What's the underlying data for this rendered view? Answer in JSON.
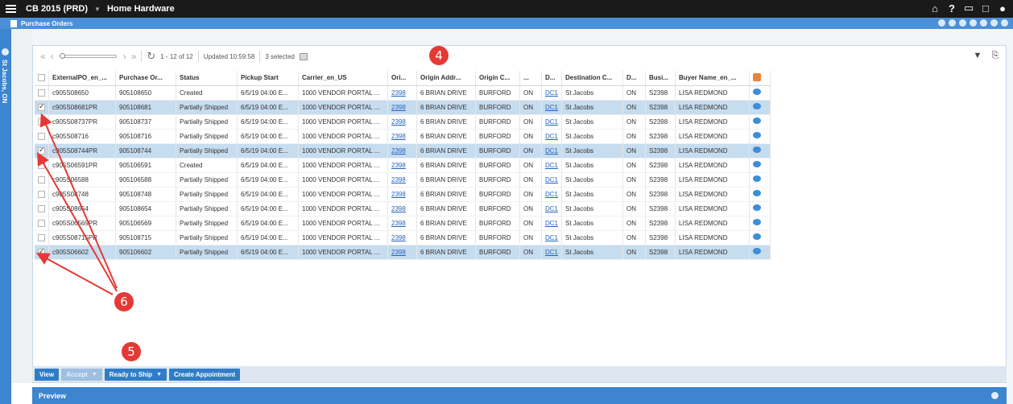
{
  "topbar": {
    "app_title": "CB 2015 (PRD)",
    "company": "Home Hardware",
    "icons": [
      "home-icon",
      "help-icon",
      "window-icon",
      "maximize-icon",
      "user-icon"
    ]
  },
  "module": {
    "title": "Purchase Orders"
  },
  "leftrail": {
    "location": "St Jacobs, ON"
  },
  "toolbar": {
    "range": "1 - 12 of 12",
    "updated": "Updated 10:59:58",
    "selected": "3 selected"
  },
  "table": {
    "columns": [
      "ExternalPO_en_...",
      "Purchase Or...",
      "Status",
      "Pickup Start",
      "Carrier_en_US",
      "Ori...",
      "Origin Addr...",
      "Origin C...",
      "...",
      "D...",
      "Destination C...",
      "D...",
      "Busi...",
      "Buyer Name_en_..."
    ],
    "rows": [
      {
        "checked": false,
        "ext": "c905S08650",
        "po": "905108650",
        "status": "Created",
        "pickup": "6/5/19 04:00 E...",
        "carrier": "1000 VENDOR PORTAL ...",
        "origin": "2398",
        "addr": "6 BRIAN DRIVE",
        "city": "BURFORD",
        "prov": "ON",
        "dest": "DC1",
        "destcity": "St Jacobs",
        "dprov": "ON",
        "bus": "S2398",
        "buyer": "LISA REDMOND"
      },
      {
        "checked": true,
        "ext": "c905S08681PR",
        "po": "905108681",
        "status": "Partially Shipped",
        "pickup": "6/5/19 04:00 E...",
        "carrier": "1000 VENDOR PORTAL ...",
        "origin": "2398",
        "addr": "6 BRIAN DRIVE",
        "city": "BURFORD",
        "prov": "ON",
        "dest": "DC1",
        "destcity": "St Jacobs",
        "dprov": "ON",
        "bus": "S2398",
        "buyer": "LISA REDMOND"
      },
      {
        "checked": false,
        "ext": "c905S08737PR",
        "po": "905108737",
        "status": "Partially Shipped",
        "pickup": "6/5/19 04:00 E...",
        "carrier": "1000 VENDOR PORTAL ...",
        "origin": "2398",
        "addr": "6 BRIAN DRIVE",
        "city": "BURFORD",
        "prov": "ON",
        "dest": "DC1",
        "destcity": "St Jacobs",
        "dprov": "ON",
        "bus": "S2398",
        "buyer": "LISA REDMOND"
      },
      {
        "checked": false,
        "ext": "c905S08716",
        "po": "905108716",
        "status": "Partially Shipped",
        "pickup": "6/5/19 04:00 E...",
        "carrier": "1000 VENDOR PORTAL ...",
        "origin": "2398",
        "addr": "6 BRIAN DRIVE",
        "city": "BURFORD",
        "prov": "ON",
        "dest": "DC1",
        "destcity": "St Jacobs",
        "dprov": "ON",
        "bus": "S2398",
        "buyer": "LISA REDMOND"
      },
      {
        "checked": true,
        "ext": "c905S08744PR",
        "po": "905108744",
        "status": "Partially Shipped",
        "pickup": "6/5/19 04:00 E...",
        "carrier": "1000 VENDOR PORTAL ...",
        "origin": "2398",
        "addr": "6 BRIAN DRIVE",
        "city": "BURFORD",
        "prov": "ON",
        "dest": "DC1",
        "destcity": "St Jacobs",
        "dprov": "ON",
        "bus": "S2398",
        "buyer": "LISA REDMOND"
      },
      {
        "checked": false,
        "ext": "c905S06591PR",
        "po": "905106591",
        "status": "Created",
        "pickup": "6/5/19 04:00 E...",
        "carrier": "1000 VENDOR PORTAL ...",
        "origin": "2398",
        "addr": "6 BRIAN DRIVE",
        "city": "BURFORD",
        "prov": "ON",
        "dest": "DC1",
        "destcity": "St Jacobs",
        "dprov": "ON",
        "bus": "S2398",
        "buyer": "LISA REDMOND"
      },
      {
        "checked": false,
        "ext": "c905S06588",
        "po": "905106588",
        "status": "Partially Shipped",
        "pickup": "6/5/19 04:00 E...",
        "carrier": "1000 VENDOR PORTAL ...",
        "origin": "2398",
        "addr": "6 BRIAN DRIVE",
        "city": "BURFORD",
        "prov": "ON",
        "dest": "DC1",
        "destcity": "St Jacobs",
        "dprov": "ON",
        "bus": "S2398",
        "buyer": "LISA REDMOND"
      },
      {
        "checked": false,
        "ext": "c905S08748",
        "po": "905108748",
        "status": "Partially Shipped",
        "pickup": "6/5/19 04:00 E...",
        "carrier": "1000 VENDOR PORTAL ...",
        "origin": "2398",
        "addr": "6 BRIAN DRIVE",
        "city": "BURFORD",
        "prov": "ON",
        "dest": "DC1",
        "destcity": "St Jacobs",
        "dprov": "ON",
        "bus": "S2398",
        "buyer": "LISA REDMOND"
      },
      {
        "checked": false,
        "ext": "c905S08654",
        "po": "905108654",
        "status": "Partially Shipped",
        "pickup": "6/5/19 04:00 E...",
        "carrier": "1000 VENDOR PORTAL ...",
        "origin": "2398",
        "addr": "6 BRIAN DRIVE",
        "city": "BURFORD",
        "prov": "ON",
        "dest": "DC1",
        "destcity": "St Jacobs",
        "dprov": "ON",
        "bus": "S2398",
        "buyer": "LISA REDMOND"
      },
      {
        "checked": false,
        "ext": "c905S06569PR",
        "po": "905106569",
        "status": "Partially Shipped",
        "pickup": "6/5/19 04:00 E...",
        "carrier": "1000 VENDOR PORTAL ...",
        "origin": "2398",
        "addr": "6 BRIAN DRIVE",
        "city": "BURFORD",
        "prov": "ON",
        "dest": "DC1",
        "destcity": "St Jacobs",
        "dprov": "ON",
        "bus": "S2398",
        "buyer": "LISA REDMOND"
      },
      {
        "checked": false,
        "ext": "c905S08715PR",
        "po": "905108715",
        "status": "Partially Shipped",
        "pickup": "6/5/19 04:00 E...",
        "carrier": "1000 VENDOR PORTAL ...",
        "origin": "2398",
        "addr": "6 BRIAN DRIVE",
        "city": "BURFORD",
        "prov": "ON",
        "dest": "DC1",
        "destcity": "St Jacobs",
        "dprov": "ON",
        "bus": "S2398",
        "buyer": "LISA REDMOND"
      },
      {
        "checked": true,
        "ext": "c905S06602",
        "po": "905106602",
        "status": "Partially Shipped",
        "pickup": "6/5/19 04:00 E...",
        "carrier": "1000 VENDOR PORTAL ...",
        "origin": "2398",
        "addr": "6 BRIAN DRIVE",
        "city": "BURFORD",
        "prov": "ON",
        "dest": "DC1",
        "destcity": "St Jacobs",
        "dprov": "ON",
        "bus": "S2398",
        "buyer": "LISA REDMOND"
      }
    ]
  },
  "actions": {
    "view": "View",
    "accept": "Accept",
    "ready_to_ship": "Ready to Ship",
    "create_appointment": "Create Appointment"
  },
  "preview": {
    "label": "Preview"
  },
  "annotations": {
    "m4": "4",
    "m5": "5",
    "m6": "6",
    "color": "#e53935"
  },
  "colors": {
    "accent": "#4a90d9",
    "selected_row": "#c6dcef",
    "topbar": "#1a1a1a"
  }
}
